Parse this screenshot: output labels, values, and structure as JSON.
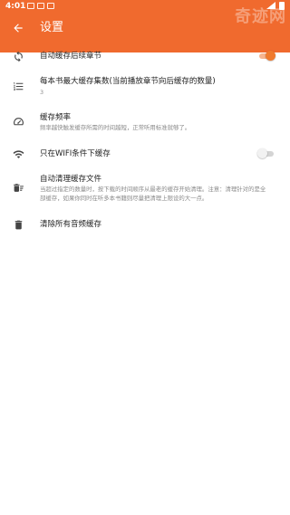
{
  "statusbar": {
    "time": "4:01"
  },
  "watermark": "奇迹网",
  "header": {
    "title": "设置",
    "accent_color": "#f06a2e",
    "back_icon": "arrow-back-icon"
  },
  "settings": [
    {
      "icon": "sync-icon",
      "title": "自动缓存后续章节",
      "toggle": true,
      "toggle_on": true
    },
    {
      "icon": "list-numbered-icon",
      "title": "每本书最大缓存集数(当前播放章节向后缓存的数量)",
      "subtitle": "3"
    },
    {
      "icon": "speedometer-icon",
      "title": "缓存频率",
      "subtitle": "频率越快触发缓存所需的时间越短，正常听用标准就够了。"
    },
    {
      "icon": "wifi-icon",
      "title": "只在WIFI条件下缓存",
      "toggle": true,
      "toggle_on": false
    },
    {
      "icon": "delete-sweep-icon",
      "title": "自动清理缓存文件",
      "subtitle": "当超过指定的数量时，按下载的时间顺序从最老的缓存开始清理。注意：清理针对的是全部缓存，如果你同时在听多本书籍则尽量把清理上限设的大一点。"
    },
    {
      "icon": "trash-icon",
      "title": "清除所有音频缓存"
    }
  ]
}
